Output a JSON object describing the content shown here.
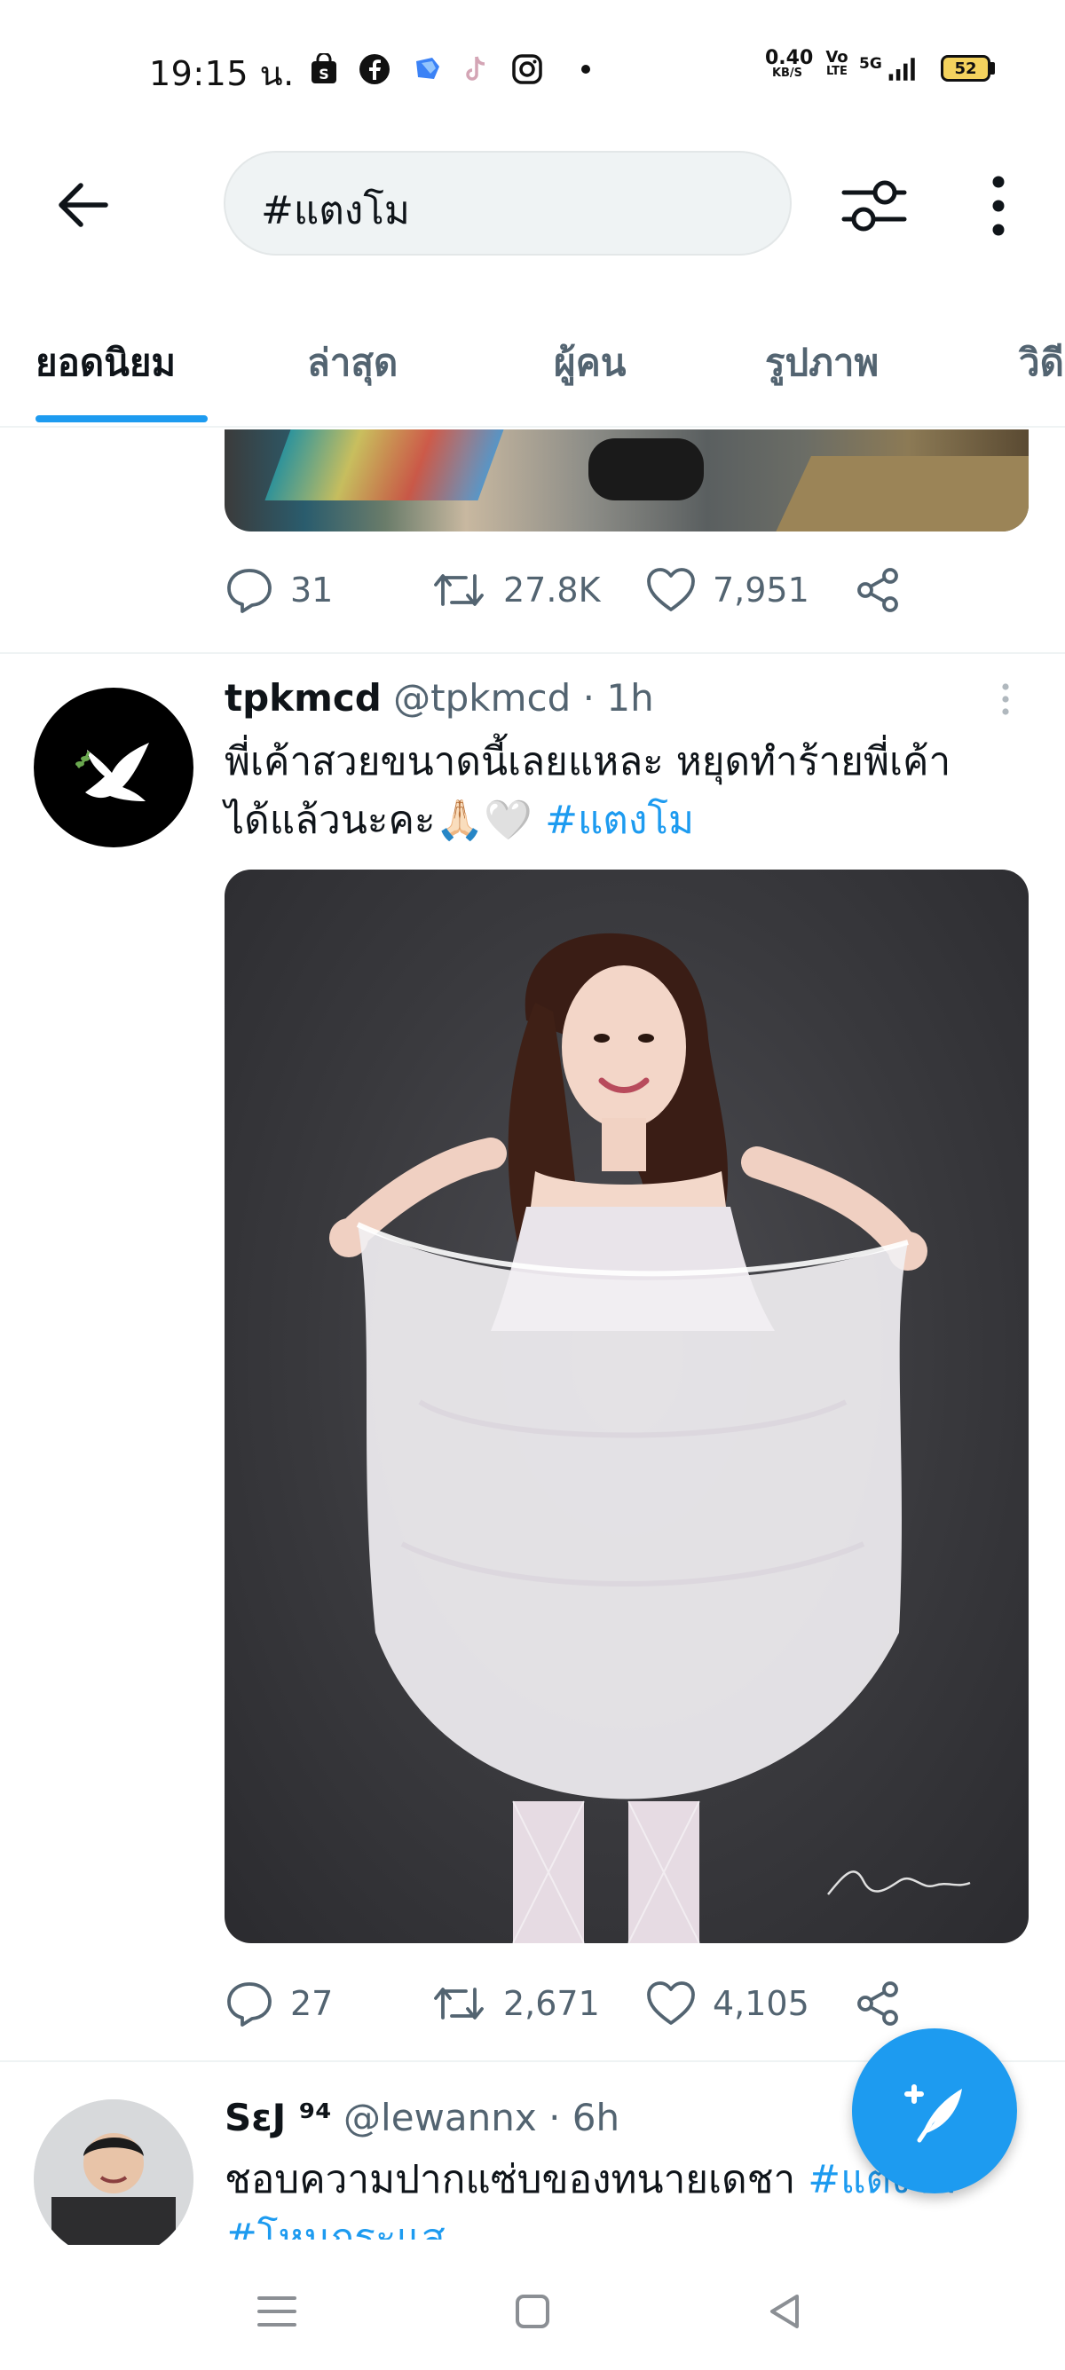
{
  "status_bar": {
    "time": "19:15 น.",
    "net_speed_top": "0.40",
    "net_speed_bottom": "KB/S",
    "volte_top": "Vo",
    "volte_bottom": "LTE",
    "network": "5G",
    "battery": "52"
  },
  "search": {
    "query": "#แตงโม"
  },
  "tabs": [
    {
      "label": "ยอดนิยม",
      "active": true
    },
    {
      "label": "ล่าสุด"
    },
    {
      "label": "ผู้คน"
    },
    {
      "label": "รูปภาพ"
    },
    {
      "label": "วิดี"
    }
  ],
  "tweets": [
    {
      "replies": "31",
      "retweets": "27.8K",
      "likes": "7,951"
    },
    {
      "name": "tpkmcd",
      "handle": "@tpkmcd",
      "time": "· 1h",
      "text_line1": "พี่เค้าสวยขนาดนี้เลยแหละ หยุดทำร้ายพี่เค้า",
      "text_line2": "ได้แล้วนะคะ🙏🏻🤍 ",
      "hashtag": "#แตงโม",
      "image_signature": "Jakanin",
      "replies": "27",
      "retweets": "2,671",
      "likes": "4,105"
    },
    {
      "name": "SεJ ⁹⁴",
      "handle": "@lewannx",
      "time": "· 6h",
      "text_line1": "ชอบความปากแซ่บของทนายเดชา ",
      "hashtag1": "#แตงโม",
      "hashtag2": "#โหนกระแส"
    }
  ],
  "colors": {
    "accent": "#1d9bf0",
    "text": "#0f1419",
    "muted": "#536471"
  }
}
